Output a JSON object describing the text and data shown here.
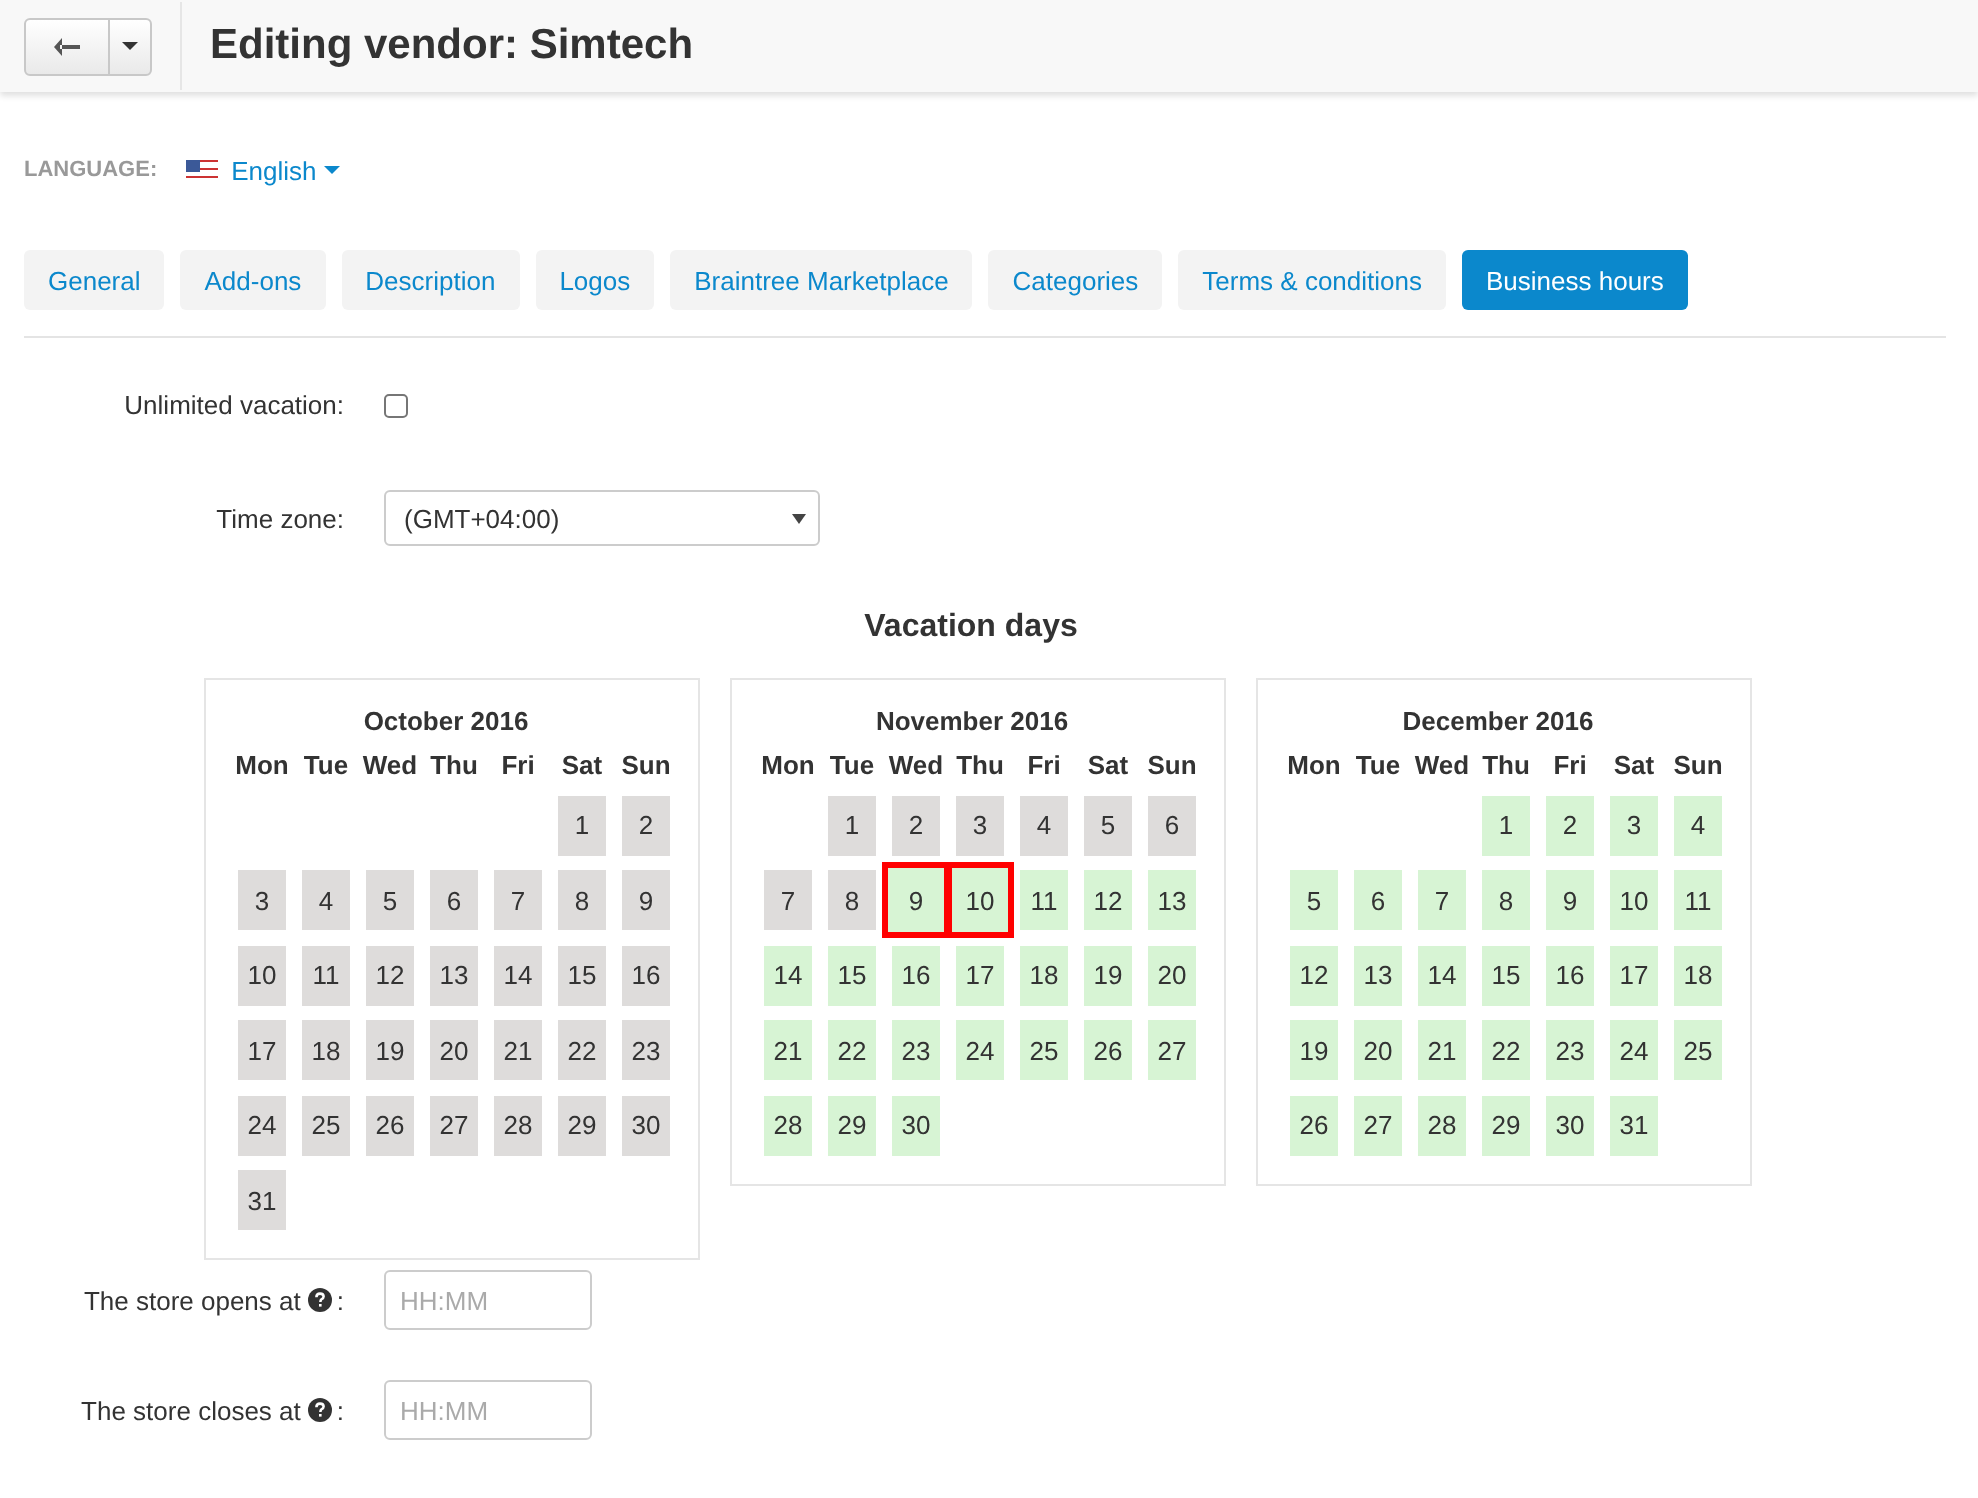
{
  "header": {
    "title": "Editing vendor: Simtech"
  },
  "language": {
    "label": "LANGUAGE:",
    "value": "English"
  },
  "tabs": [
    {
      "label": "General",
      "selected": false
    },
    {
      "label": "Add-ons",
      "selected": false
    },
    {
      "label": "Description",
      "selected": false
    },
    {
      "label": "Logos",
      "selected": false
    },
    {
      "label": "Braintree Marketplace",
      "selected": false
    },
    {
      "label": "Categories",
      "selected": false
    },
    {
      "label": "Terms & conditions",
      "selected": false
    },
    {
      "label": "Business hours",
      "selected": true
    }
  ],
  "unlimited_vacation": {
    "label": "Unlimited vacation:",
    "checked": false
  },
  "time_zone": {
    "label": "Time zone:",
    "value": "(GMT+04:00)"
  },
  "vacation_title": "Vacation days",
  "calendars": [
    {
      "title": "October 2016",
      "weekdays": [
        "Mon",
        "Tue",
        "Wed",
        "Thu",
        "Fri",
        "Sat",
        "Sun"
      ],
      "days": [
        {
          "kind": "blank"
        },
        {
          "kind": "blank"
        },
        {
          "kind": "blank"
        },
        {
          "kind": "blank"
        },
        {
          "kind": "blank"
        },
        {
          "label": "1",
          "kind": "past",
          "selected": false
        },
        {
          "label": "2",
          "kind": "past",
          "selected": false
        },
        {
          "label": "3",
          "kind": "past",
          "selected": false
        },
        {
          "label": "4",
          "kind": "past",
          "selected": false
        },
        {
          "label": "5",
          "kind": "past",
          "selected": false
        },
        {
          "label": "6",
          "kind": "past",
          "selected": false
        },
        {
          "label": "7",
          "kind": "past",
          "selected": false
        },
        {
          "label": "8",
          "kind": "past",
          "selected": false
        },
        {
          "label": "9",
          "kind": "past",
          "selected": false
        },
        {
          "label": "10",
          "kind": "past",
          "selected": false
        },
        {
          "label": "11",
          "kind": "past",
          "selected": false
        },
        {
          "label": "12",
          "kind": "past",
          "selected": false
        },
        {
          "label": "13",
          "kind": "past",
          "selected": false
        },
        {
          "label": "14",
          "kind": "past",
          "selected": false
        },
        {
          "label": "15",
          "kind": "past",
          "selected": false
        },
        {
          "label": "16",
          "kind": "past",
          "selected": false
        },
        {
          "label": "17",
          "kind": "past",
          "selected": false
        },
        {
          "label": "18",
          "kind": "past",
          "selected": false
        },
        {
          "label": "19",
          "kind": "past",
          "selected": false
        },
        {
          "label": "20",
          "kind": "past",
          "selected": false
        },
        {
          "label": "21",
          "kind": "past",
          "selected": false
        },
        {
          "label": "22",
          "kind": "past",
          "selected": false
        },
        {
          "label": "23",
          "kind": "past",
          "selected": false
        },
        {
          "label": "24",
          "kind": "past",
          "selected": false
        },
        {
          "label": "25",
          "kind": "past",
          "selected": false
        },
        {
          "label": "26",
          "kind": "past",
          "selected": false
        },
        {
          "label": "27",
          "kind": "past",
          "selected": false
        },
        {
          "label": "28",
          "kind": "past",
          "selected": false
        },
        {
          "label": "29",
          "kind": "past",
          "selected": false
        },
        {
          "label": "30",
          "kind": "past",
          "selected": false
        },
        {
          "label": "31",
          "kind": "past",
          "selected": false
        }
      ]
    },
    {
      "title": "November 2016",
      "weekdays": [
        "Mon",
        "Tue",
        "Wed",
        "Thu",
        "Fri",
        "Sat",
        "Sun"
      ],
      "days": [
        {
          "kind": "blank"
        },
        {
          "label": "1",
          "kind": "past",
          "selected": false
        },
        {
          "label": "2",
          "kind": "past",
          "selected": false
        },
        {
          "label": "3",
          "kind": "past",
          "selected": false
        },
        {
          "label": "4",
          "kind": "past",
          "selected": false
        },
        {
          "label": "5",
          "kind": "past",
          "selected": false
        },
        {
          "label": "6",
          "kind": "past",
          "selected": false
        },
        {
          "label": "7",
          "kind": "past",
          "selected": false
        },
        {
          "label": "8",
          "kind": "past",
          "selected": false
        },
        {
          "label": "9",
          "kind": "open",
          "selected": true
        },
        {
          "label": "10",
          "kind": "open",
          "selected": true
        },
        {
          "label": "11",
          "kind": "open",
          "selected": false
        },
        {
          "label": "12",
          "kind": "open",
          "selected": false
        },
        {
          "label": "13",
          "kind": "open",
          "selected": false
        },
        {
          "label": "14",
          "kind": "open",
          "selected": false
        },
        {
          "label": "15",
          "kind": "open",
          "selected": false
        },
        {
          "label": "16",
          "kind": "open",
          "selected": false
        },
        {
          "label": "17",
          "kind": "open",
          "selected": false
        },
        {
          "label": "18",
          "kind": "open",
          "selected": false
        },
        {
          "label": "19",
          "kind": "open",
          "selected": false
        },
        {
          "label": "20",
          "kind": "open",
          "selected": false
        },
        {
          "label": "21",
          "kind": "open",
          "selected": false
        },
        {
          "label": "22",
          "kind": "open",
          "selected": false
        },
        {
          "label": "23",
          "kind": "open",
          "selected": false
        },
        {
          "label": "24",
          "kind": "open",
          "selected": false
        },
        {
          "label": "25",
          "kind": "open",
          "selected": false
        },
        {
          "label": "26",
          "kind": "open",
          "selected": false
        },
        {
          "label": "27",
          "kind": "open",
          "selected": false
        },
        {
          "label": "28",
          "kind": "open",
          "selected": false
        },
        {
          "label": "29",
          "kind": "open",
          "selected": false
        },
        {
          "label": "30",
          "kind": "open",
          "selected": false
        }
      ]
    },
    {
      "title": "December 2016",
      "weekdays": [
        "Mon",
        "Tue",
        "Wed",
        "Thu",
        "Fri",
        "Sat",
        "Sun"
      ],
      "days": [
        {
          "kind": "blank"
        },
        {
          "kind": "blank"
        },
        {
          "kind": "blank"
        },
        {
          "label": "1",
          "kind": "open",
          "selected": false
        },
        {
          "label": "2",
          "kind": "open",
          "selected": false
        },
        {
          "label": "3",
          "kind": "open",
          "selected": false
        },
        {
          "label": "4",
          "kind": "open",
          "selected": false
        },
        {
          "label": "5",
          "kind": "open",
          "selected": false
        },
        {
          "label": "6",
          "kind": "open",
          "selected": false
        },
        {
          "label": "7",
          "kind": "open",
          "selected": false
        },
        {
          "label": "8",
          "kind": "open",
          "selected": false
        },
        {
          "label": "9",
          "kind": "open",
          "selected": false
        },
        {
          "label": "10",
          "kind": "open",
          "selected": false
        },
        {
          "label": "11",
          "kind": "open",
          "selected": false
        },
        {
          "label": "12",
          "kind": "open",
          "selected": false
        },
        {
          "label": "13",
          "kind": "open",
          "selected": false
        },
        {
          "label": "14",
          "kind": "open",
          "selected": false
        },
        {
          "label": "15",
          "kind": "open",
          "selected": false
        },
        {
          "label": "16",
          "kind": "open",
          "selected": false
        },
        {
          "label": "17",
          "kind": "open",
          "selected": false
        },
        {
          "label": "18",
          "kind": "open",
          "selected": false
        },
        {
          "label": "19",
          "kind": "open",
          "selected": false
        },
        {
          "label": "20",
          "kind": "open",
          "selected": false
        },
        {
          "label": "21",
          "kind": "open",
          "selected": false
        },
        {
          "label": "22",
          "kind": "open",
          "selected": false
        },
        {
          "label": "23",
          "kind": "open",
          "selected": false
        },
        {
          "label": "24",
          "kind": "open",
          "selected": false
        },
        {
          "label": "25",
          "kind": "open",
          "selected": false
        },
        {
          "label": "26",
          "kind": "open",
          "selected": false
        },
        {
          "label": "27",
          "kind": "open",
          "selected": false
        },
        {
          "label": "28",
          "kind": "open",
          "selected": false
        },
        {
          "label": "29",
          "kind": "open",
          "selected": false
        },
        {
          "label": "30",
          "kind": "open",
          "selected": false
        },
        {
          "label": "31",
          "kind": "open",
          "selected": false
        }
      ]
    }
  ],
  "hours": [
    {
      "label": "The store opens at",
      "colon": ":",
      "placeholder": "HH:MM"
    },
    {
      "label": "The store closes at",
      "colon": ":",
      "placeholder": "HH:MM"
    }
  ]
}
